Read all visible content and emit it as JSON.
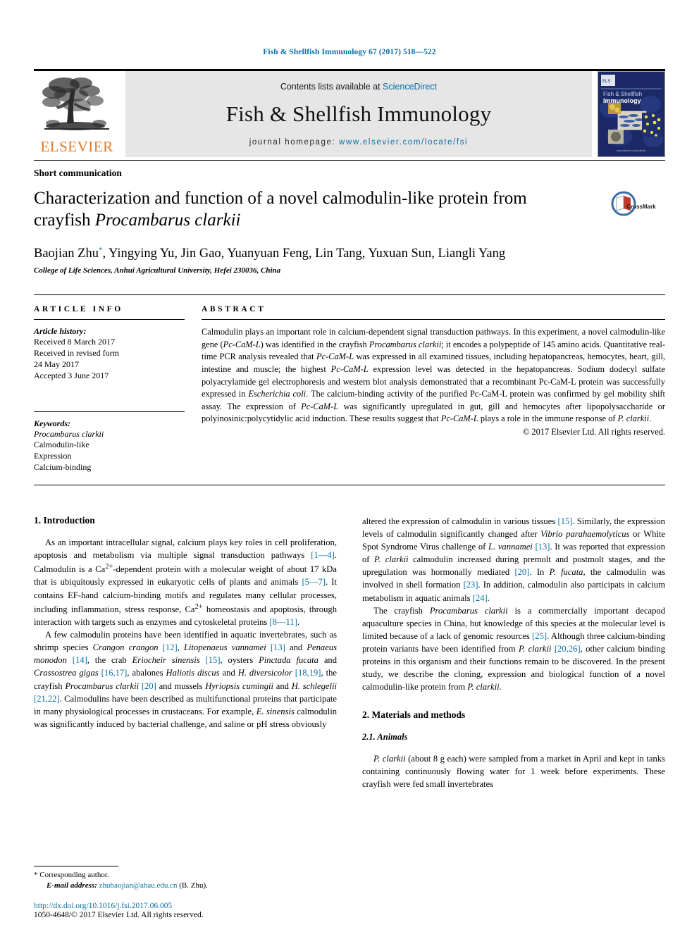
{
  "running_head": "Fish & Shellfish Immunology 67 (2017) 518—522",
  "masthead": {
    "publisher_wordmark": "ELSEVIER",
    "contents_prefix": "Contents lists available at ",
    "contents_link": "ScienceDirect",
    "journal_title": "Fish & Shellfish Immunology",
    "homepage_prefix": "journal homepage: ",
    "homepage_link": "www.elsevier.com/locate/fsi",
    "cover_title_line1": "Fish & Shellfish",
    "cover_title_line2": "Immunology",
    "cover_footer": "www.elsevier.com/locate/fsi"
  },
  "article": {
    "type": "Short communication",
    "title_line1": "Characterization and function of a novel calmodulin-like protein from",
    "title_line2_plain": "crayfish ",
    "title_line2_italic": "Procambarus clarkii",
    "crossmark_label": "CrossMark",
    "authors": "Baojian Zhu, Yingying Yu, Jin Gao, Yuanyuan Feng, Lin Tang, Yuxuan Sun, Liangli Yang",
    "author_marker": "*",
    "affiliation": "College of Life Sciences, Anhui Agricultural University, Hefei 230036, China"
  },
  "article_info": {
    "heading": "ARTICLE INFO",
    "history_label": "Article history:",
    "history": [
      "Received 8 March 2017",
      "Received in revised form",
      "24 May 2017",
      "Accepted 3 June 2017"
    ],
    "keywords_label": "Keywords:",
    "keywords": [
      "Procambarus clarkii",
      "Calmodulin-like",
      "Expression",
      "Calcium-binding"
    ]
  },
  "abstract": {
    "heading": "ABSTRACT",
    "p1_a": "Calmodulin plays an important role in calcium-dependent signal transduction pathways. In this experiment, a novel calmodulin-like gene (",
    "p1_i1": "Pc-CaM-L",
    "p1_b": ") was identified in the crayfish ",
    "p1_i2": "Procambarus clarkii",
    "p1_c": "; it encodes a polypeptide of 145 amino acids. Quantitative real-time PCR analysis revealed that ",
    "p1_i3": "Pc-CaM-L",
    "p1_d": " was expressed in all examined tissues, including hepatopancreas, hemocytes, heart, gill, intestine and muscle; the highest ",
    "p1_i4": "Pc-CaM-L",
    "p1_e": " expression level was detected in the hepatopancreas. Sodium dodecyl sulfate polyacrylamide gel electrophoresis and western blot analysis demonstrated that a recombinant Pc-CaM-L protein was successfully expressed in ",
    "p1_i5": "Escherichia coli",
    "p1_f": ". The calcium-binding activity of the purified Pc-CaM-L protein was confirmed by gel mobility shift assay. The expression of ",
    "p1_i6": "Pc-CaM-L",
    "p1_g": " was significantly upregulated in gut, gill and hemocytes after lipopolysaccharide or polyinosinic:polycytidylic acid induction. These results suggest that ",
    "p1_i7": "Pc-CaM-L",
    "p1_h": " plays a role in the immune response of ",
    "p1_i8": "P. clarkii",
    "p1_i": ".",
    "copyright": "© 2017 Elsevier Ltd. All rights reserved."
  },
  "sections": {
    "intro_heading": "1. Introduction",
    "methods_heading": "2. Materials and methods",
    "animals_heading": "2.1. Animals"
  },
  "body": {
    "left_p1": {
      "a": "As an important intracellular signal, calcium plays key roles in cell proliferation, apoptosis and metabolism via multiple signal transduction pathways ",
      "c1": "[1—4]",
      "b": ". Calmodulin is a Ca",
      "sup1": "2+",
      "c": "-dependent protein with a molecular weight of about 17 kDa that is ubiquitously expressed in eukaryotic cells of plants and animals ",
      "c2": "[5—7]",
      "d": ". It contains EF-hand calcium-binding motifs and regulates many cellular processes, including inflammation, stress response, Ca",
      "sup2": "2+",
      "e": " homeostasis and apoptosis, through interaction with targets such as enzymes and cytoskeletal proteins ",
      "c3": "[8—11]",
      "f": "."
    },
    "left_p2": {
      "a": "A few calmodulin proteins have been identified in aquatic invertebrates, such as shrimp species ",
      "i1": "Crangon crangon",
      "b": " ",
      "c1": "[12]",
      "c": ", ",
      "i2": "Litopenaeus vannamei",
      "d": " ",
      "c2": "[13]",
      "e": " and ",
      "i3": "Penaeus monodon",
      "f": " ",
      "c3": "[14]",
      "g": ", the crab ",
      "i4": "Eriocheir sinensis",
      "h": " ",
      "c4": "[15]",
      "i": ", oysters ",
      "i5": "Pinctada fucata",
      "j": " and ",
      "i6": "Crassostrea gigas",
      "k": " ",
      "c5": "[16,17]",
      "l": ", abalones ",
      "i7": "Haliotis discus",
      "m": " and ",
      "i8": "H. diversicolor",
      "n": " ",
      "c6": "[18,19]",
      "o": ", the crayfish ",
      "i9": "Procambarus clarkii",
      "p": " ",
      "c7": "[20]",
      "q": " and mussels ",
      "i10": "Hyriopsis cumingii",
      "r": " and ",
      "i11": "H. schlegelii",
      "s": " ",
      "c8": "[21,22]",
      "t": ". Calmodulins have been described as multifunctional proteins that participate in many physiological processes in crustaceans. For example, ",
      "i12": "E. sinensis",
      "u": " calmodulin was significantly induced by bacterial challenge, and saline or pH stress obviously"
    },
    "right_p1": {
      "a": "altered the expression of calmodulin in various tissues ",
      "c1": "[15]",
      "b": ". Similarly, the expression levels of calmodulin significantly changed after ",
      "i1": "Vibrio parahaemolyticus",
      "c": " or White Spot Syndrome Virus challenge of ",
      "i2": "L. vannamei",
      "d": " ",
      "c2": "[13]",
      "e": ". It was reported that expression of ",
      "i3": "P. clarkii",
      "f": " calmodulin increased during premolt and postmolt stages, and the upregulation was hormonally mediated ",
      "c3": "[20]",
      "g": ". In ",
      "i4": "P. fucata",
      "h": ", the calmodulin was involved in shell formation ",
      "c4": "[23]",
      "i": ". In addition, calmodulin also participats in calcium metabolism in aquatic animals ",
      "c5": "[24]",
      "j": "."
    },
    "right_p2": {
      "a": "The crayfish ",
      "i1": "Procambarus clarkii",
      "b": " is a commercially important decapod aquaculture species in China, but knowledge of this species at the molecular level is limited because of a lack of genomic resources ",
      "c1": "[25]",
      "c": ". Although three calcium-binding protein variants have been identified from ",
      "i2": "P. clarkii",
      "d": " ",
      "c2": "[20,26]",
      "e": ", other calcium binding proteins in this organism and their functions remain to be discovered. In the present study, we describe the cloning, expression and biological function of a novel calmodulin-like protein from ",
      "i3": "P. clarkii",
      "f": "."
    },
    "right_p3": {
      "i1": "P. clarkii",
      "a": " (about 8 g each) were sampled from a market in April and kept in tanks containing continuously flowing water for 1 week before experiments. These crayfish were fed small invertebrates"
    }
  },
  "footer": {
    "corresponding_marker": "*",
    "corresponding_label": "Corresponding author.",
    "email_label": "E-mail address:",
    "email": "zhubaojian@ahau.edu.cn",
    "email_suffix": "(B. Zhu).",
    "doi": "http://dx.doi.org/10.1016/j.fsi.2017.06.005",
    "issn_line": "1050-4648/© 2017 Elsevier Ltd. All rights reserved."
  },
  "colors": {
    "link": "#0b6ea8",
    "elsevier_orange": "#E87722",
    "masthead_bg": "#e6e6e6",
    "cover_bg": "#1b2a66"
  }
}
